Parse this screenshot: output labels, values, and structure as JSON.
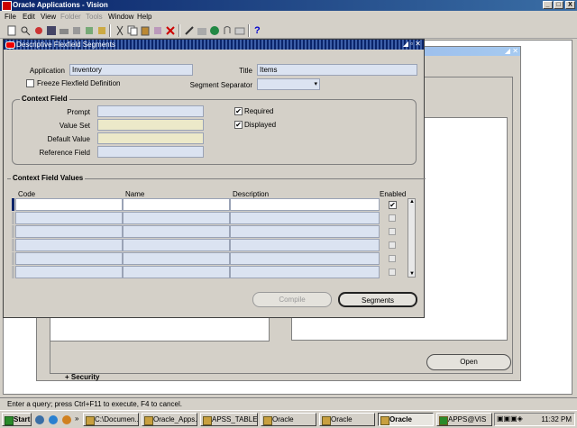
{
  "app": {
    "title": "Oracle Applications - Vision",
    "min": "_",
    "max": "□",
    "close": "X"
  },
  "menu": [
    "File",
    "Edit",
    "View",
    "Folder",
    "Tools",
    "Window",
    "Help"
  ],
  "menu_disabled": [
    "Folder",
    "Tools"
  ],
  "toolbar": {
    "help_symbol": "?"
  },
  "background_window": {
    "security_item": "+ Security",
    "open_button": "Open"
  },
  "dialog": {
    "title": "Descriptive Flexfield Segments",
    "application_label": "Application",
    "application_value": "Inventory",
    "title_label": "Title",
    "title_value": "Items",
    "freeze_label": "Freeze Flexfield Definition",
    "segment_separator_label": "Segment Separator",
    "context_field": {
      "group_title": "Context Field",
      "prompt_label": "Prompt",
      "value_set_label": "Value Set",
      "default_value_label": "Default Value",
      "reference_field_label": "Reference Field",
      "required_label": "Required",
      "displayed_label": "Displayed"
    },
    "context_values": {
      "group_title": "Context Field Values",
      "columns": {
        "code": "Code",
        "name": "Name",
        "description": "Description",
        "enabled": "Enabled"
      }
    },
    "compile_button": "Compile",
    "segments_button": "Segments"
  },
  "status_bar": {
    "message": "Enter a query; press Ctrl+F11 to execute, F4 to cancel."
  },
  "taskbar": {
    "start": "Start",
    "tasks": [
      "C:\\Documen...",
      "Oracle_Apps...",
      "APSS_TABLE...",
      "Oracle Applic...",
      "Oracle Applic...",
      "Oracle Appl...",
      "APPS@VIS"
    ],
    "clock": "11:32 PM"
  }
}
